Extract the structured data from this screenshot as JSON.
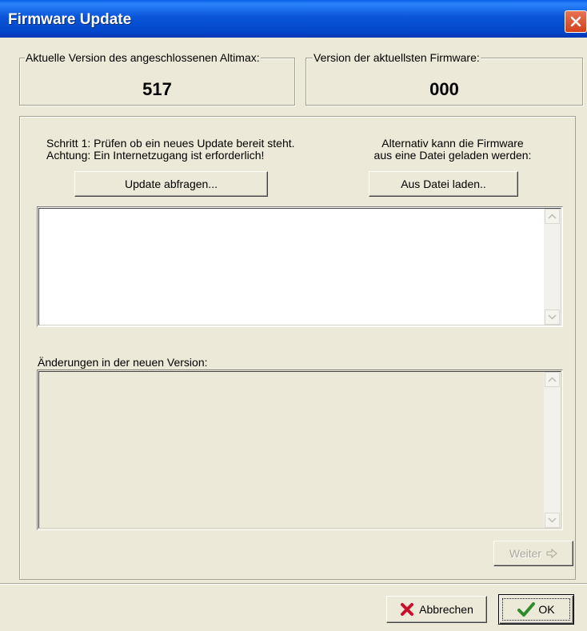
{
  "window": {
    "title": "Firmware Update"
  },
  "current_version": {
    "legend": "Aktuelle Version des angeschlossenen Altimax:",
    "value": "517"
  },
  "latest_version": {
    "legend": "Version der aktuellsten Firmware:",
    "value": "000"
  },
  "step1": {
    "line1": "Schritt 1: Prüfen ob ein neues Update bereit steht.",
    "line2": "Achtung: Ein Internetzugang ist erforderlich!",
    "button": "Update abfragen..."
  },
  "alternative": {
    "line1": "Alternativ kann die Firmware",
    "line2": "aus eine Datei geladen werden:",
    "button": "Aus Datei laden.."
  },
  "changes": {
    "label": "Änderungen in der neuen Version:"
  },
  "buttons": {
    "next": "Weiter",
    "cancel": "Abbrechen",
    "ok": "OK"
  },
  "colors": {
    "title_bar": "#0a55d8",
    "dialog_bg": "#ece9d8",
    "cancel_icon": "#c8102e",
    "ok_icon": "#2e8b2e"
  }
}
